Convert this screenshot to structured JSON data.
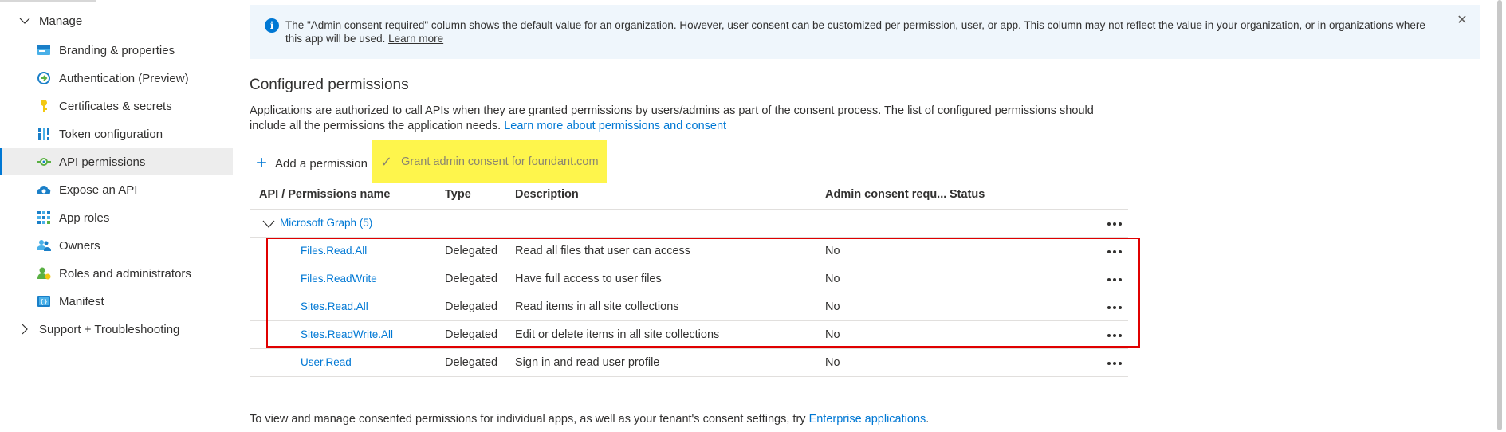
{
  "sidebar": {
    "manage_group": {
      "label": "Manage"
    },
    "items": [
      {
        "label": "Branding & properties",
        "icon": "branding-icon"
      },
      {
        "label": "Authentication (Preview)",
        "icon": "authentication-icon"
      },
      {
        "label": "Certificates & secrets",
        "icon": "key-icon"
      },
      {
        "label": "Token configuration",
        "icon": "token-bars-icon"
      },
      {
        "label": "API permissions",
        "icon": "api-permissions-icon",
        "active": true
      },
      {
        "label": "Expose an API",
        "icon": "cloud-icon"
      },
      {
        "label": "App roles",
        "icon": "grid-icon"
      },
      {
        "label": "Owners",
        "icon": "people-icon"
      },
      {
        "label": "Roles and administrators",
        "icon": "person-badge-icon"
      },
      {
        "label": "Manifest",
        "icon": "manifest-icon"
      }
    ],
    "support_group": {
      "label": "Support + Troubleshooting"
    }
  },
  "info_bar": {
    "text": "The \"Admin consent required\" column shows the default value for an organization. However, user consent can be customized per permission, user, or app. This column may not reflect the value in your organization, or in organizations where this app will be used.",
    "link": "Learn more"
  },
  "section": {
    "title": "Configured permissions",
    "description": "Applications are authorized to call APIs when they are granted permissions by users/admins as part of the consent process. The list of configured permissions should include all the permissions the application needs.",
    "description_link": "Learn more about permissions and consent"
  },
  "commands": {
    "add_permission": "Add a permission",
    "grant_consent": "Grant admin consent for foundant.com"
  },
  "table": {
    "headers": {
      "name": "API / Permissions name",
      "type": "Type",
      "description": "Description",
      "admin": "Admin consent requ...",
      "status": "Status"
    },
    "group": {
      "label": "Microsoft Graph (5)"
    },
    "rows": [
      {
        "name": "Files.Read.All",
        "type": "Delegated",
        "description": "Read all files that user can access",
        "admin": "No",
        "status": ""
      },
      {
        "name": "Files.ReadWrite",
        "type": "Delegated",
        "description": "Have full access to user files",
        "admin": "No",
        "status": ""
      },
      {
        "name": "Sites.Read.All",
        "type": "Delegated",
        "description": "Read items in all site collections",
        "admin": "No",
        "status": ""
      },
      {
        "name": "Sites.ReadWrite.All",
        "type": "Delegated",
        "description": "Edit or delete items in all site collections",
        "admin": "No",
        "status": ""
      },
      {
        "name": "User.Read",
        "type": "Delegated",
        "description": "Sign in and read user profile",
        "admin": "No",
        "status": ""
      }
    ]
  },
  "footer": {
    "text": "To view and manage consented permissions for individual apps, as well as your tenant's consent settings, try",
    "link": "Enterprise applications",
    "end": "."
  },
  "colors": {
    "accent": "#0078d4",
    "highlight": "#fef54c",
    "annotation_box": "#e00000",
    "info_bg": "#eff6fc"
  }
}
